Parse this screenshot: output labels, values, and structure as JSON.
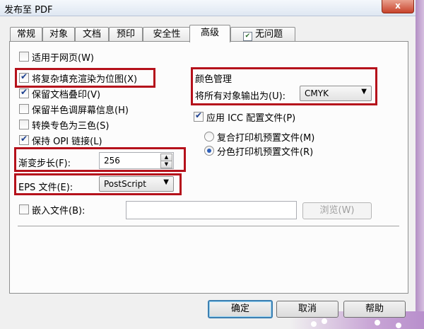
{
  "window": {
    "title": "发布至 PDF",
    "close": "x"
  },
  "tabs": [
    "常规",
    "对象",
    "文档",
    "预印",
    "安全性",
    "高级",
    "无问题"
  ],
  "left_options": [
    {
      "label": "适用于网页(W)",
      "checked": false
    },
    {
      "label": "将复杂填充渲染为位图(X)",
      "checked": true
    },
    {
      "label": "保留文档叠印(V)",
      "checked": true
    },
    {
      "label": "保留半色调屏幕信息(H)",
      "checked": false
    },
    {
      "label": "转换专色为三色(S)",
      "checked": false
    },
    {
      "label": "保持 OPI 链接(L)",
      "checked": true
    }
  ],
  "gradient": {
    "label": "渐变步长(F):",
    "value": "256"
  },
  "eps": {
    "label": "EPS 文件(E):",
    "value": "PostScript"
  },
  "embed": {
    "label": "嵌入文件(B):",
    "value": "",
    "browse": "浏览(W)"
  },
  "color": {
    "title": "颜色管理",
    "output_label": "将所有对象输出为(U):",
    "output_value": "CMYK",
    "icc_label": "应用 ICC 配置文件(P)",
    "radio1": "复合打印机预置文件(M)",
    "radio2": "分色打印机预置文件(R)"
  },
  "buttons": {
    "ok": "确定",
    "cancel": "取消",
    "help": "帮助"
  },
  "colors": {
    "highlight": "#b5111b",
    "accent": "#3c7fb1"
  }
}
